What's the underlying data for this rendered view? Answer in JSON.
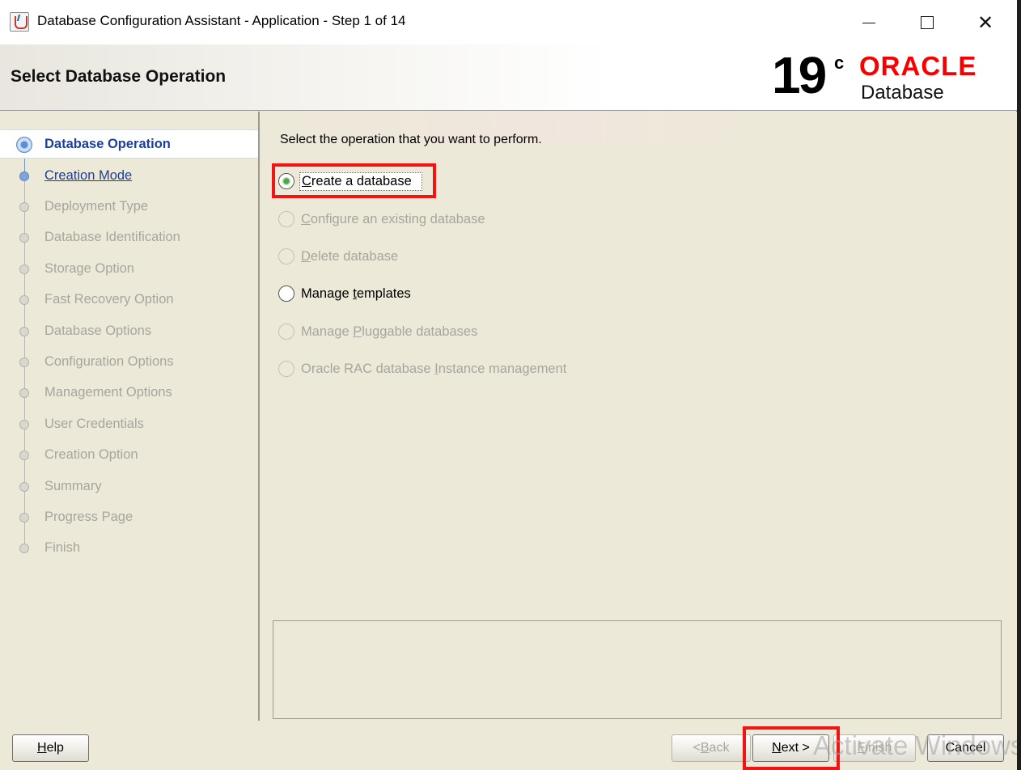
{
  "window": {
    "title": "Database Configuration Assistant - Application - Step 1 of 14"
  },
  "header": {
    "page_title": "Select Database Operation",
    "brand_version": "19",
    "brand_version_sup": "c",
    "brand_name": "ORACLE",
    "brand_product": "Database",
    "brand_color": "#f80000"
  },
  "nav": {
    "items": [
      {
        "label": "Database Operation",
        "state": "current"
      },
      {
        "label": "Creation Mode",
        "state": "link"
      },
      {
        "label": "Deployment Type",
        "state": "disabled"
      },
      {
        "label": "Database Identification",
        "state": "disabled"
      },
      {
        "label": "Storage Option",
        "state": "disabled"
      },
      {
        "label": "Fast Recovery Option",
        "state": "disabled"
      },
      {
        "label": "Database Options",
        "state": "disabled"
      },
      {
        "label": "Configuration Options",
        "state": "disabled"
      },
      {
        "label": "Management Options",
        "state": "disabled"
      },
      {
        "label": "User Credentials",
        "state": "disabled"
      },
      {
        "label": "Creation Option",
        "state": "disabled"
      },
      {
        "label": "Summary",
        "state": "disabled"
      },
      {
        "label": "Progress Page",
        "state": "disabled"
      },
      {
        "label": "Finish",
        "state": "disabled"
      }
    ]
  },
  "content": {
    "prompt": "Select the operation that you want to perform.",
    "options": [
      {
        "pre": "",
        "mnemonic": "C",
        "post": "reate a database",
        "checked": true,
        "enabled": true
      },
      {
        "pre": "",
        "mnemonic": "C",
        "post": "onfigure an existing database",
        "checked": false,
        "enabled": false
      },
      {
        "pre": "",
        "mnemonic": "D",
        "post": "elete database",
        "checked": false,
        "enabled": false
      },
      {
        "pre": "Manage ",
        "mnemonic": "t",
        "post": "emplates",
        "checked": false,
        "enabled": true
      },
      {
        "pre": "Manage ",
        "mnemonic": "P",
        "post": "luggable databases",
        "checked": false,
        "enabled": false
      },
      {
        "pre": "Oracle RAC database ",
        "mnemonic": "I",
        "post": "nstance management",
        "checked": false,
        "enabled": false
      }
    ]
  },
  "buttons": {
    "help": {
      "mnemonic": "H",
      "rest": "elp"
    },
    "back": {
      "pre": "< ",
      "mnemonic": "B",
      "rest": "ack"
    },
    "next": {
      "mnemonic": "N",
      "rest": "ext >"
    },
    "finish": {
      "mnemonic": "F",
      "rest": "inish"
    },
    "cancel": "Cancel"
  },
  "watermark": "Activate Windows",
  "highlight_color": "#f21313"
}
